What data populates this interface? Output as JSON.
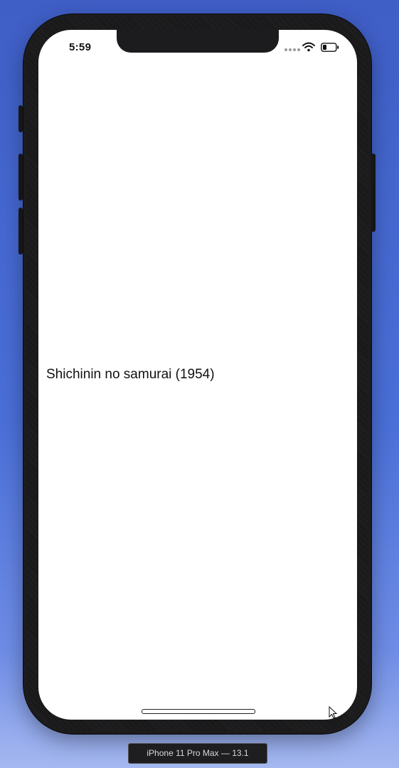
{
  "status_bar": {
    "time": "5:59",
    "signal_icon": "cellular-signal-icon",
    "wifi_icon": "wifi-icon",
    "battery_icon": "battery-icon"
  },
  "content": {
    "movie_title": "Shichinin no samurai (1954)"
  },
  "simulator": {
    "device_label": "iPhone 11 Pro Max — 13.1"
  },
  "colors": {
    "desktop_background": "#4a6fd8",
    "screen_background": "#ffffff",
    "device_frame": "#1c1c1e",
    "text": "#111111"
  }
}
